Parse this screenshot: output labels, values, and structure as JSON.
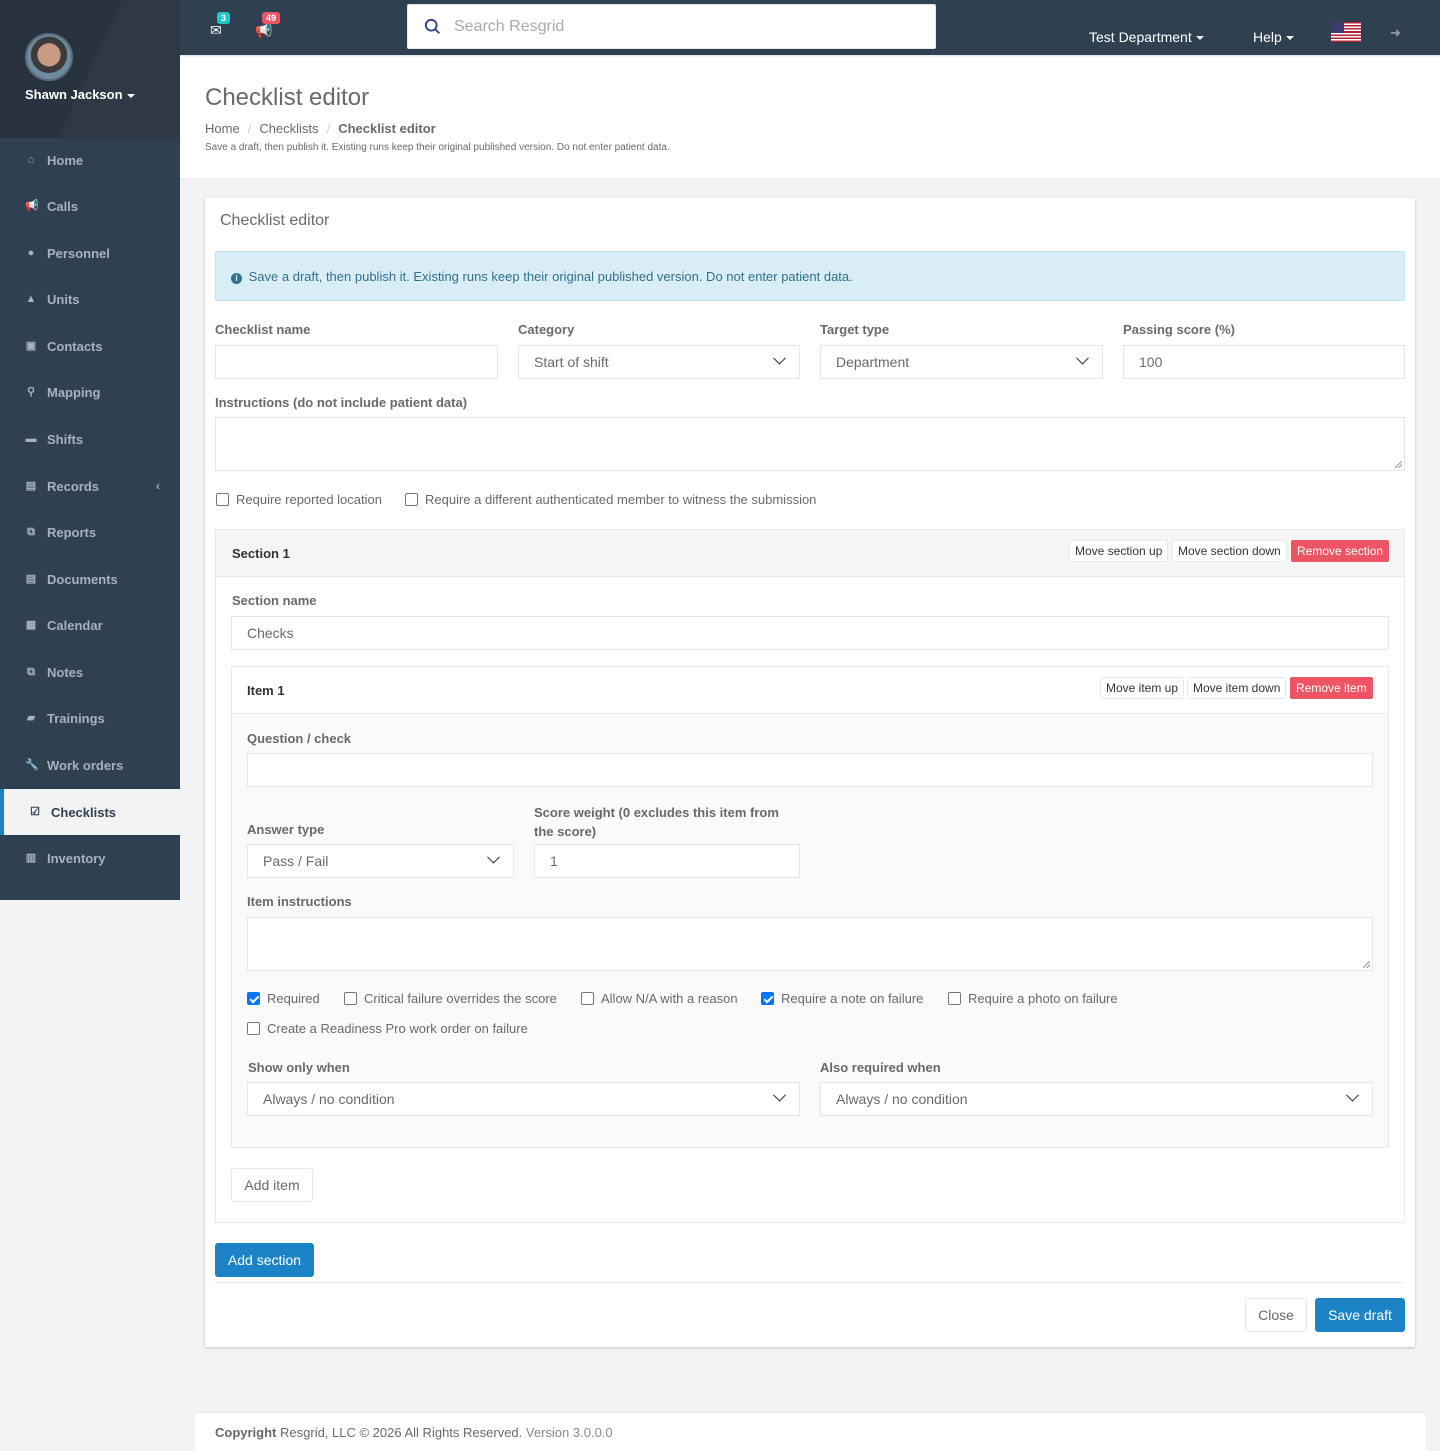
{
  "user": {
    "name": "Shawn Jackson"
  },
  "nav": [
    {
      "label": "Home",
      "icon": "home-icon",
      "glyph": "⌂"
    },
    {
      "label": "Calls",
      "icon": "bullhorn-icon",
      "glyph": "📢"
    },
    {
      "label": "Personnel",
      "icon": "user-icon",
      "glyph": "●"
    },
    {
      "label": "Units",
      "icon": "truck-icon",
      "glyph": "▲"
    },
    {
      "label": "Contacts",
      "icon": "address-book-icon",
      "glyph": "▣"
    },
    {
      "label": "Mapping",
      "icon": "map-marker-icon",
      "glyph": "⚲"
    },
    {
      "label": "Shifts",
      "icon": "briefcase-icon",
      "glyph": "▬"
    },
    {
      "label": "Records",
      "icon": "file-icon",
      "glyph": "▤"
    },
    {
      "label": "Reports",
      "icon": "copy-icon",
      "glyph": "⧉"
    },
    {
      "label": "Documents",
      "icon": "document-icon",
      "glyph": "▤"
    },
    {
      "label": "Calendar",
      "icon": "calendar-icon",
      "glyph": "▦"
    },
    {
      "label": "Notes",
      "icon": "notes-icon",
      "glyph": "⧉"
    },
    {
      "label": "Trainings",
      "icon": "book-icon",
      "glyph": "▰"
    },
    {
      "label": "Work orders",
      "icon": "wrench-icon",
      "glyph": "🔧"
    },
    {
      "label": "Checklists",
      "icon": "check-square-icon",
      "glyph": "☑"
    },
    {
      "label": "Inventory",
      "icon": "barcode-icon",
      "glyph": "▥"
    }
  ],
  "topbar": {
    "messages_count": "3",
    "calls_count": "49",
    "search_placeholder": "Search Resgrid",
    "department": "Test Department",
    "help": "Help"
  },
  "header": {
    "title": "Checklist editor",
    "breadcrumb": [
      "Home",
      "Checklists",
      "Checklist editor"
    ],
    "note": "Save a draft, then publish it. Existing runs keep their original published version. Do not enter patient data."
  },
  "panel": {
    "title": "Checklist editor",
    "alert": "Save a draft, then publish it. Existing runs keep their original published version. Do not enter patient data.",
    "fields": {
      "name_label": "Checklist name",
      "name_value": "",
      "category_label": "Category",
      "category_value": "Start of shift",
      "target_label": "Target type",
      "target_value": "Department",
      "passing_label": "Passing score (%)",
      "passing_value": "100",
      "instructions_label": "Instructions (do not include patient data)"
    },
    "options": {
      "require_location": "Require reported location",
      "require_witness": "Require a different authenticated member to witness the submission"
    },
    "section": {
      "title": "Section 1",
      "move_up": "Move section up",
      "move_down": "Move section down",
      "remove": "Remove section",
      "name_label": "Section name",
      "name_value": "Checks",
      "item": {
        "title": "Item 1",
        "move_up": "Move item up",
        "move_down": "Move item down",
        "remove": "Remove item",
        "question_label": "Question / check",
        "question_value": "",
        "answer_type_label": "Answer type",
        "answer_type_value": "Pass / Fail",
        "score_weight_label": "Score weight (0 excludes this item from the score)",
        "score_weight_value": "1",
        "instructions_label": "Item instructions",
        "checks": {
          "required": "Required",
          "critical": "Critical failure overrides the score",
          "allow_na": "Allow N/A with a reason",
          "note_on_failure": "Require a note on failure",
          "photo_on_failure": "Require a photo on failure",
          "work_order": "Create a Readiness Pro work order on failure"
        },
        "show_only_label": "Show only when",
        "show_only_value": "Always / no condition",
        "also_required_label": "Also required when",
        "also_required_value": "Always / no condition"
      },
      "add_item": "Add item"
    },
    "add_section": "Add section",
    "close": "Close",
    "save_draft": "Save draft"
  },
  "footer": {
    "copyright": "Copyright",
    "company": "Resgrid, LLC © 2026 All Rights Reserved.",
    "version": "Version 3.0.0.0"
  }
}
